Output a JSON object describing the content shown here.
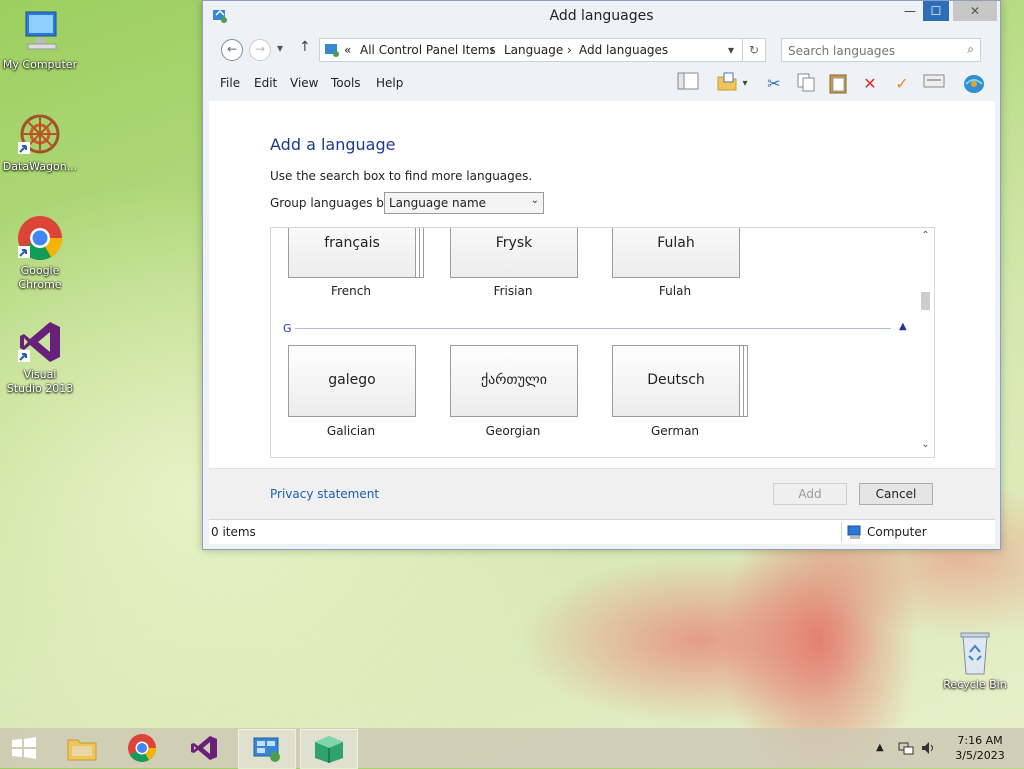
{
  "desktop": {
    "icons": [
      {
        "label": "My Computer"
      },
      {
        "label": "DataWagon..."
      },
      {
        "label": "Google Chrome"
      },
      {
        "label": "Visual Studio 2013"
      },
      {
        "label": "Recycle Bin"
      }
    ]
  },
  "window": {
    "title": "Add languages",
    "controls": {
      "minimize": "—",
      "maximize": "☐",
      "close": "✕"
    }
  },
  "address": {
    "back": "←",
    "forward": "→",
    "dropdown": "▾",
    "up": "↑",
    "prefix": "«",
    "crumbs": [
      "All Control Panel Items",
      "Language",
      "Add languages"
    ],
    "separator": "›",
    "refresh": "↻"
  },
  "search": {
    "placeholder": "Search languages"
  },
  "menu": {
    "file": "File",
    "edit": "Edit",
    "view": "View",
    "tools": "Tools",
    "help": "Help"
  },
  "content": {
    "heading": "Add a language",
    "hint": "Use the search box to find more languages.",
    "group_by_label": "Group languages by:",
    "group_by_value": "Language name",
    "group_letter": "G",
    "tiles": [
      {
        "native": "français",
        "name": "French"
      },
      {
        "native": "Frysk",
        "name": "Frisian"
      },
      {
        "native": "Fulah",
        "name": "Fulah"
      },
      {
        "native": "galego",
        "name": "Galician"
      },
      {
        "native": "ქართული",
        "name": "Georgian"
      },
      {
        "native": "Deutsch",
        "name": "German"
      }
    ]
  },
  "footer": {
    "privacy": "Privacy statement",
    "add": "Add",
    "cancel": "Cancel"
  },
  "status": {
    "items": "0 items",
    "location": "Computer"
  },
  "taskbar": {
    "time": "7:16 AM",
    "date": "3/5/2023"
  }
}
